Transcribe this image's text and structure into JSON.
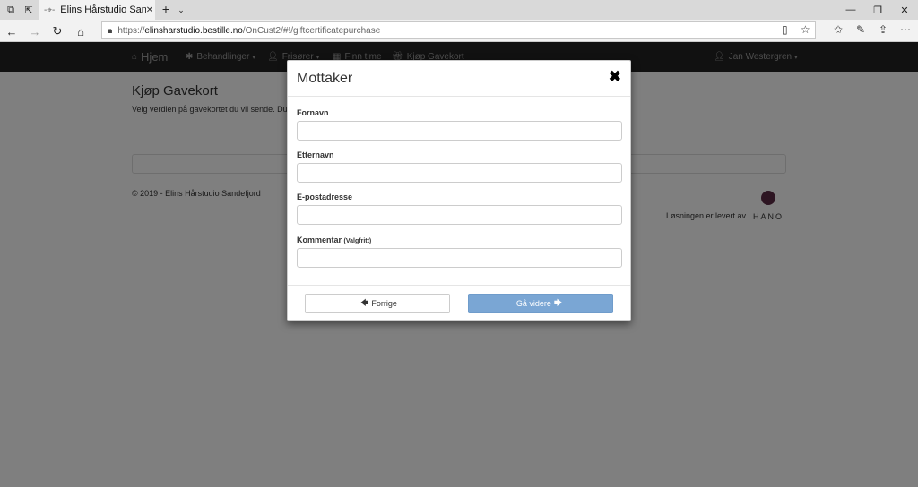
{
  "browser": {
    "tab_title": "Elins Hårstudio Sandefjo",
    "url_scheme": "https://",
    "url_host": "elinsharstudio.bestille.no",
    "url_path": "/OnCust2/#!/giftcertificatepurchase"
  },
  "navbar": {
    "brand": "Hjem",
    "items": [
      "Behandlinger",
      "Frisører",
      "Finn time",
      "Kjøp Gavekort"
    ],
    "user": "Jan Westergren"
  },
  "page": {
    "title": "Kjøp Gavekort",
    "description": "Velg verdien på gavekortet du vil sende. Du",
    "copyright": "© 2019 - Elins Hårstudio Sandefjord",
    "credit": "Løsningen er levert av",
    "logo_text": "HANO"
  },
  "modal": {
    "title": "Mottaker",
    "fields": [
      {
        "label": "Fornavn",
        "value": ""
      },
      {
        "label": "Etternavn",
        "value": ""
      },
      {
        "label": "E-postadresse",
        "value": ""
      },
      {
        "label": "Kommentar",
        "hint": "(Valgfritt)",
        "value": ""
      }
    ],
    "prev_label": "Forrige",
    "next_label": "Gå videre"
  },
  "colors": {
    "navbar_bg": "#222222",
    "primary_button": "#7aa6d4",
    "overlay": "rgba(0,0,0,0.5)"
  }
}
